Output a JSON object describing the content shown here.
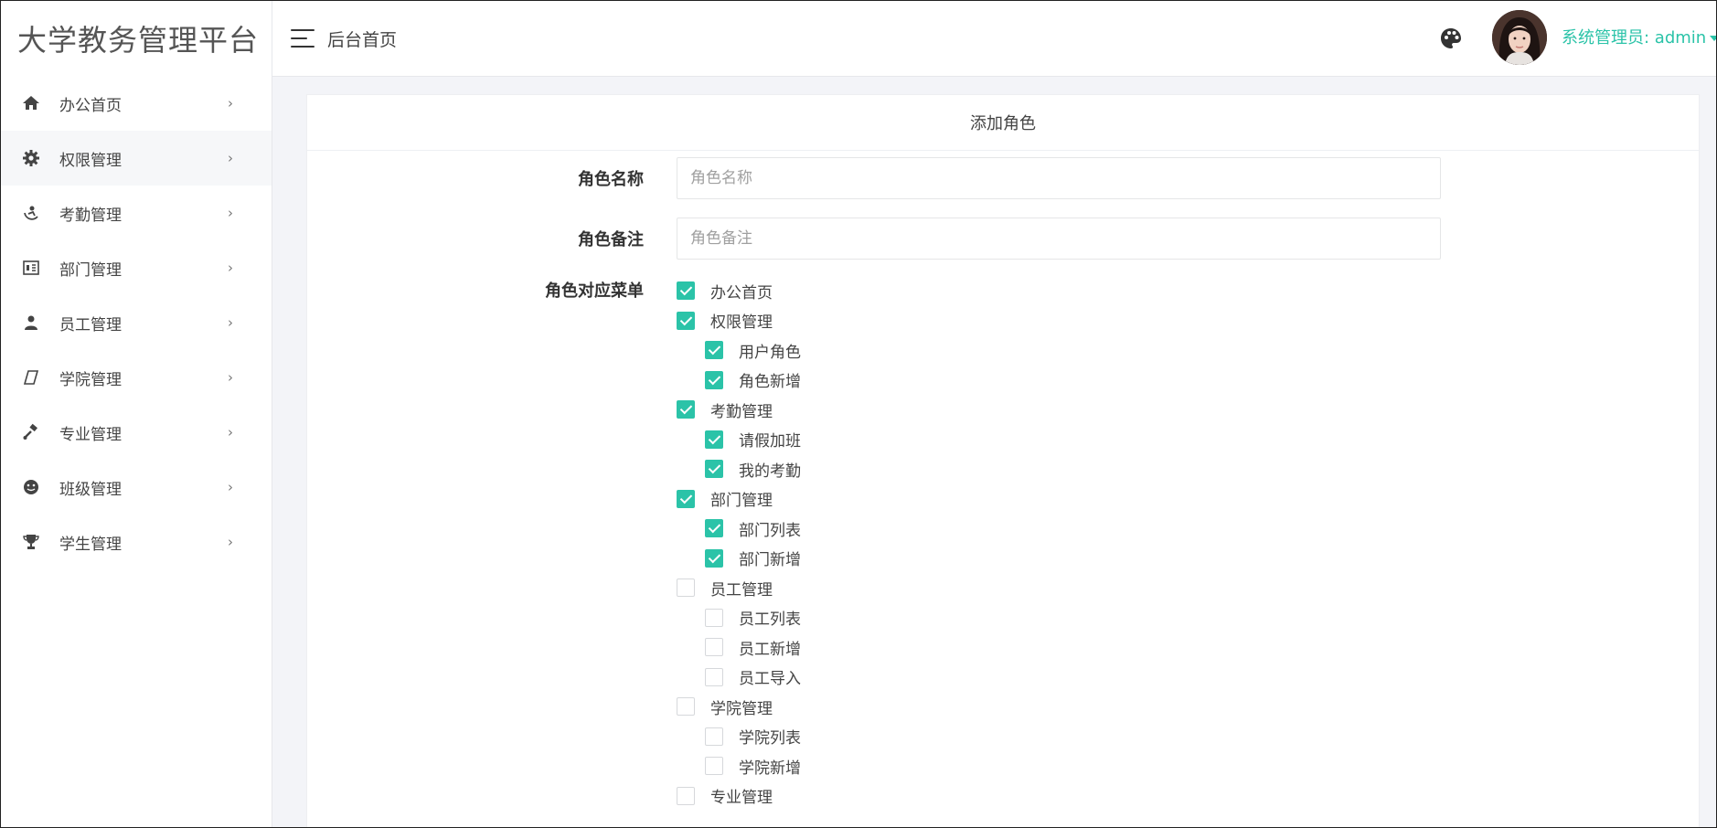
{
  "app": {
    "title": "大学教务管理平台"
  },
  "header": {
    "breadcrumb": "后台首页",
    "user": "系统管理员: admin"
  },
  "sidebar": {
    "items": [
      {
        "label": "办公首页",
        "icon": "home-icon"
      },
      {
        "label": "权限管理",
        "icon": "gear-icon"
      },
      {
        "label": "考勤管理",
        "icon": "attendance-icon"
      },
      {
        "label": "部门管理",
        "icon": "id-card-icon"
      },
      {
        "label": "员工管理",
        "icon": "user-icon"
      },
      {
        "label": "学院管理",
        "icon": "parallelogram-icon"
      },
      {
        "label": "专业管理",
        "icon": "gavel-icon"
      },
      {
        "label": "班级管理",
        "icon": "smiley-icon"
      },
      {
        "label": "学生管理",
        "icon": "trophy-icon"
      }
    ],
    "chevron": "›"
  },
  "form": {
    "title": "添加角色",
    "name_label": "角色名称",
    "name_placeholder": "角色名称",
    "name_value": "",
    "remark_label": "角色备注",
    "remark_placeholder": "角色备注",
    "remark_value": "",
    "menu_label": "角色对应菜单",
    "menu_tree": [
      {
        "label": "办公首页",
        "checked": true,
        "level": 0
      },
      {
        "label": "权限管理",
        "checked": true,
        "level": 0
      },
      {
        "label": "用户角色",
        "checked": true,
        "level": 1
      },
      {
        "label": "角色新增",
        "checked": true,
        "level": 1
      },
      {
        "label": "考勤管理",
        "checked": true,
        "level": 0
      },
      {
        "label": "请假加班",
        "checked": true,
        "level": 1
      },
      {
        "label": "我的考勤",
        "checked": true,
        "level": 1
      },
      {
        "label": "部门管理",
        "checked": true,
        "level": 0
      },
      {
        "label": "部门列表",
        "checked": true,
        "level": 1
      },
      {
        "label": "部门新增",
        "checked": true,
        "level": 1
      },
      {
        "label": "员工管理",
        "checked": false,
        "level": 0
      },
      {
        "label": "员工列表",
        "checked": false,
        "level": 1
      },
      {
        "label": "员工新增",
        "checked": false,
        "level": 1
      },
      {
        "label": "员工导入",
        "checked": false,
        "level": 1
      },
      {
        "label": "学院管理",
        "checked": false,
        "level": 0
      },
      {
        "label": "学院列表",
        "checked": false,
        "level": 1
      },
      {
        "label": "学院新增",
        "checked": false,
        "level": 1
      },
      {
        "label": "专业管理",
        "checked": false,
        "level": 0
      }
    ]
  },
  "colors": {
    "accent": "#2bc3a8",
    "sidebar_active": "#f6f7f9",
    "page_bg": "#f3f4f8"
  }
}
